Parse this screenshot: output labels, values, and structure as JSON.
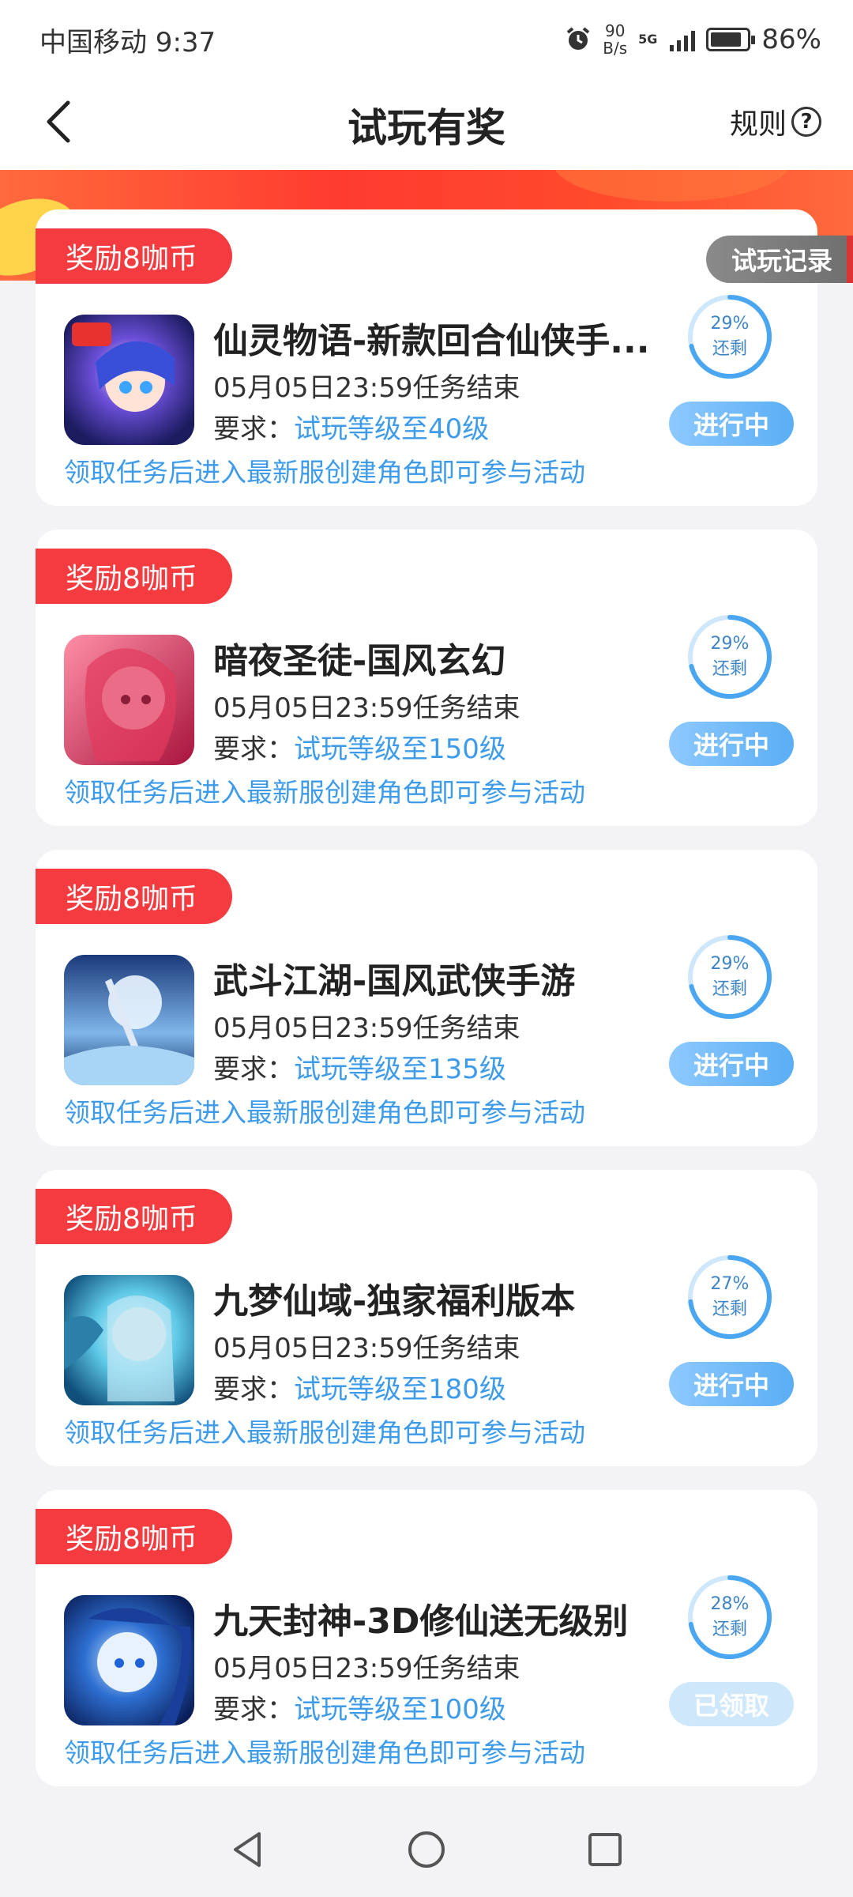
{
  "status_bar": {
    "carrier_time": "中国移动 9:37",
    "net_rate_value": "90",
    "net_rate_unit": "B/s",
    "network": "5G",
    "battery": "86%",
    "battery_level": 0.86
  },
  "header": {
    "title": "试玩有奖",
    "rules_label": "规则"
  },
  "records_label": "试玩记录",
  "tasks": [
    {
      "reward": "奖励8咖币",
      "name": "仙灵物语-新款回合仙侠手...",
      "deadline": "05月05日23:59任务结束",
      "req_label": "要求：",
      "req_value": "试玩等级至40级",
      "hint": "领取任务后进入最新服创建角色即可参与活动",
      "percent": "29%",
      "percent_value": 0.29,
      "remain_label": "还剩",
      "status": "进行中",
      "icon_name": "game-icon-xianling"
    },
    {
      "reward": "奖励8咖币",
      "name": "暗夜圣徒-国风玄幻",
      "deadline": "05月05日23:59任务结束",
      "req_label": "要求：",
      "req_value": "试玩等级至150级",
      "hint": "领取任务后进入最新服创建角色即可参与活动",
      "percent": "29%",
      "percent_value": 0.29,
      "remain_label": "还剩",
      "status": "进行中",
      "icon_name": "game-icon-anye"
    },
    {
      "reward": "奖励8咖币",
      "name": "武斗江湖-国风武侠手游",
      "deadline": "05月05日23:59任务结束",
      "req_label": "要求：",
      "req_value": "试玩等级至135级",
      "hint": "领取任务后进入最新服创建角色即可参与活动",
      "percent": "29%",
      "percent_value": 0.29,
      "remain_label": "还剩",
      "status": "进行中",
      "icon_name": "game-icon-wudou"
    },
    {
      "reward": "奖励8咖币",
      "name": "九梦仙域-独家福利版本",
      "deadline": "05月05日23:59任务结束",
      "req_label": "要求：",
      "req_value": "试玩等级至180级",
      "hint": "领取任务后进入最新服创建角色即可参与活动",
      "percent": "27%",
      "percent_value": 0.27,
      "remain_label": "还剩",
      "status": "进行中",
      "icon_name": "game-icon-jiumeng"
    },
    {
      "reward": "奖励8咖币",
      "name": "九天封神-3D修仙送无级别",
      "deadline": "05月05日23:59任务结束",
      "req_label": "要求：",
      "req_value": "试玩等级至100级",
      "hint": "领取任务后进入最新服创建角色即可参与活动",
      "percent": "28%",
      "percent_value": 0.28,
      "remain_label": "还剩",
      "status": "已领取",
      "icon_name": "game-icon-jiutian"
    }
  ],
  "colors": {
    "accent_red": "#f43b3f",
    "accent_blue": "#3d9be9",
    "ring_blue": "#4aa6f0",
    "ring_light": "#cfe7fb"
  }
}
